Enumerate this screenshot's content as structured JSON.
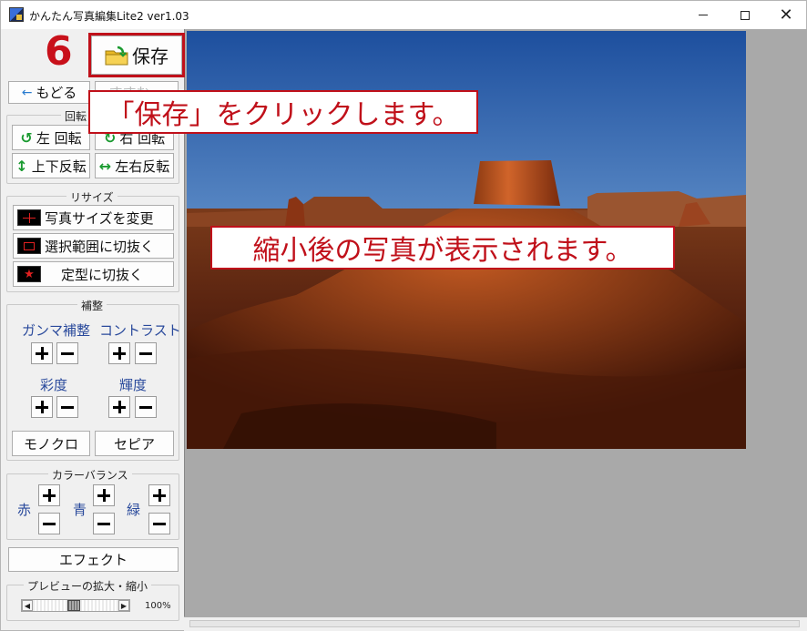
{
  "window": {
    "title": "かんたん写真編集Lite2 ver1.03"
  },
  "toolbar": {
    "save_label": "保存",
    "back_label": "もどる",
    "forward_label": "すすむ"
  },
  "rotate": {
    "group_label": "回転",
    "left_label": "左 回転",
    "right_label": "右 回転",
    "flip_v_label": "上下反転",
    "flip_h_label": "左右反転"
  },
  "resize": {
    "group_label": "リサイズ",
    "change_size_label": "写真サイズを変更",
    "crop_selection_label": "選択範囲に切抜く",
    "crop_fixed_label": "定型に切抜く"
  },
  "correction": {
    "group_label": "補整",
    "gamma_label": "ガンマ補整",
    "contrast_label": "コントラスト",
    "saturation_label": "彩度",
    "brightness_label": "輝度",
    "mono_label": "モノクロ",
    "sepia_label": "セピア"
  },
  "color_balance": {
    "group_label": "カラーバランス",
    "red_label": "赤",
    "green_label": "青",
    "blue_label": "緑"
  },
  "effect": {
    "label": "エフェクト"
  },
  "preview": {
    "group_label": "プレビューの拡大・縮小",
    "zoom": "100%"
  },
  "annotations": {
    "step_number": "6",
    "save_callout": "「保存」をクリックします。",
    "preview_callout": "縮小後の写真が表示されます。"
  },
  "colors": {
    "annotation_red": "#c0101a",
    "label_blue": "#2a4a9c",
    "canvas_gray": "#a9a9a9"
  }
}
